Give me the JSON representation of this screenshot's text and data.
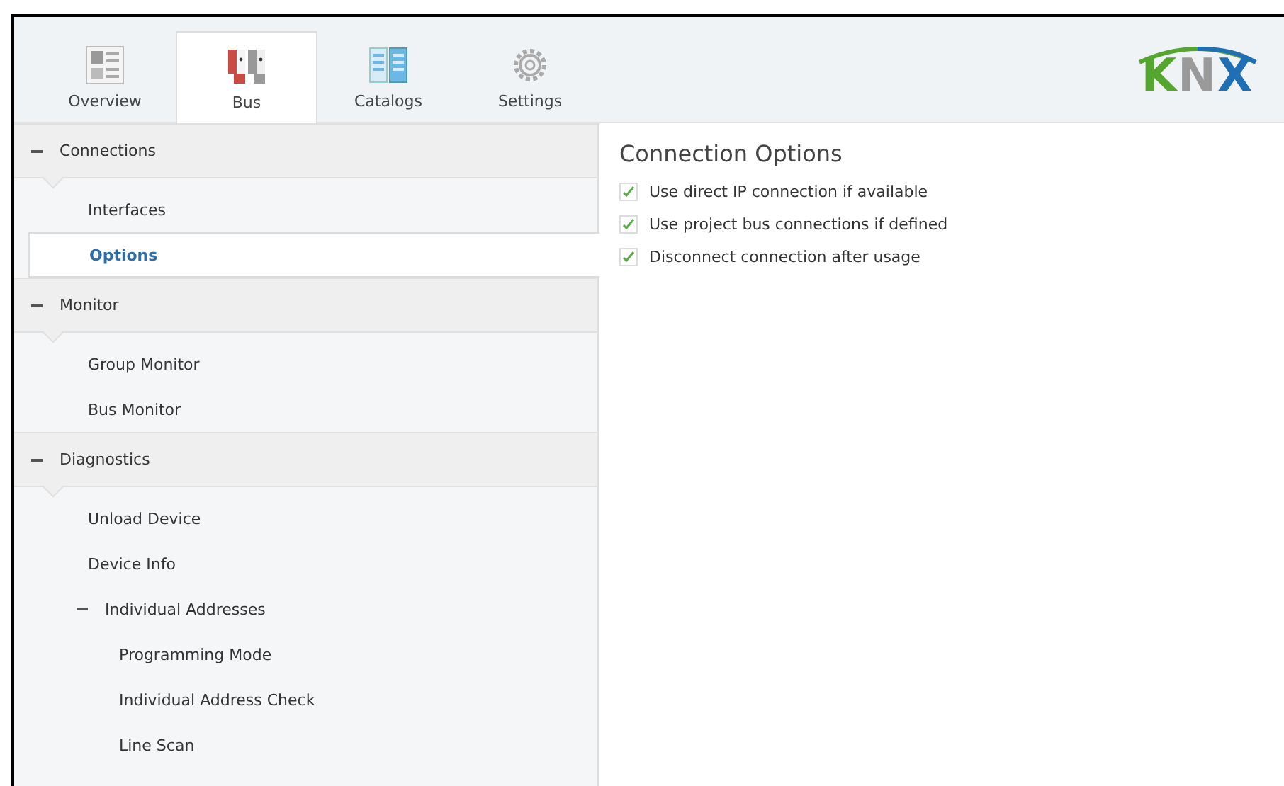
{
  "tabs": [
    {
      "label": "Overview",
      "selected": false
    },
    {
      "label": "Bus",
      "selected": true
    },
    {
      "label": "Catalogs",
      "selected": false
    },
    {
      "label": "Settings",
      "selected": false
    }
  ],
  "logo": {
    "text": "KNX"
  },
  "sidebar": {
    "sections": [
      {
        "title": "Connections",
        "expanded": true,
        "items": [
          {
            "label": "Interfaces",
            "selected": false
          },
          {
            "label": "Options",
            "selected": true
          }
        ]
      },
      {
        "title": "Monitor",
        "expanded": true,
        "items": [
          {
            "label": "Group Monitor",
            "selected": false
          },
          {
            "label": "Bus Monitor",
            "selected": false
          }
        ]
      },
      {
        "title": "Diagnostics",
        "expanded": true,
        "items": [
          {
            "label": "Unload Device",
            "selected": false
          },
          {
            "label": "Device Info",
            "selected": false
          },
          {
            "label": "Individual Addresses",
            "selected": false,
            "expanded": true,
            "children": [
              {
                "label": "Programming Mode",
                "selected": false
              },
              {
                "label": "Individual Address Check",
                "selected": false
              },
              {
                "label": "Line Scan",
                "selected": false
              }
            ]
          }
        ]
      }
    ]
  },
  "content": {
    "title": "Connection Options",
    "options": [
      {
        "label": "Use direct IP connection if available",
        "checked": true
      },
      {
        "label": "Use project bus connections if defined",
        "checked": true
      },
      {
        "label": "Disconnect connection after usage",
        "checked": true
      }
    ]
  }
}
